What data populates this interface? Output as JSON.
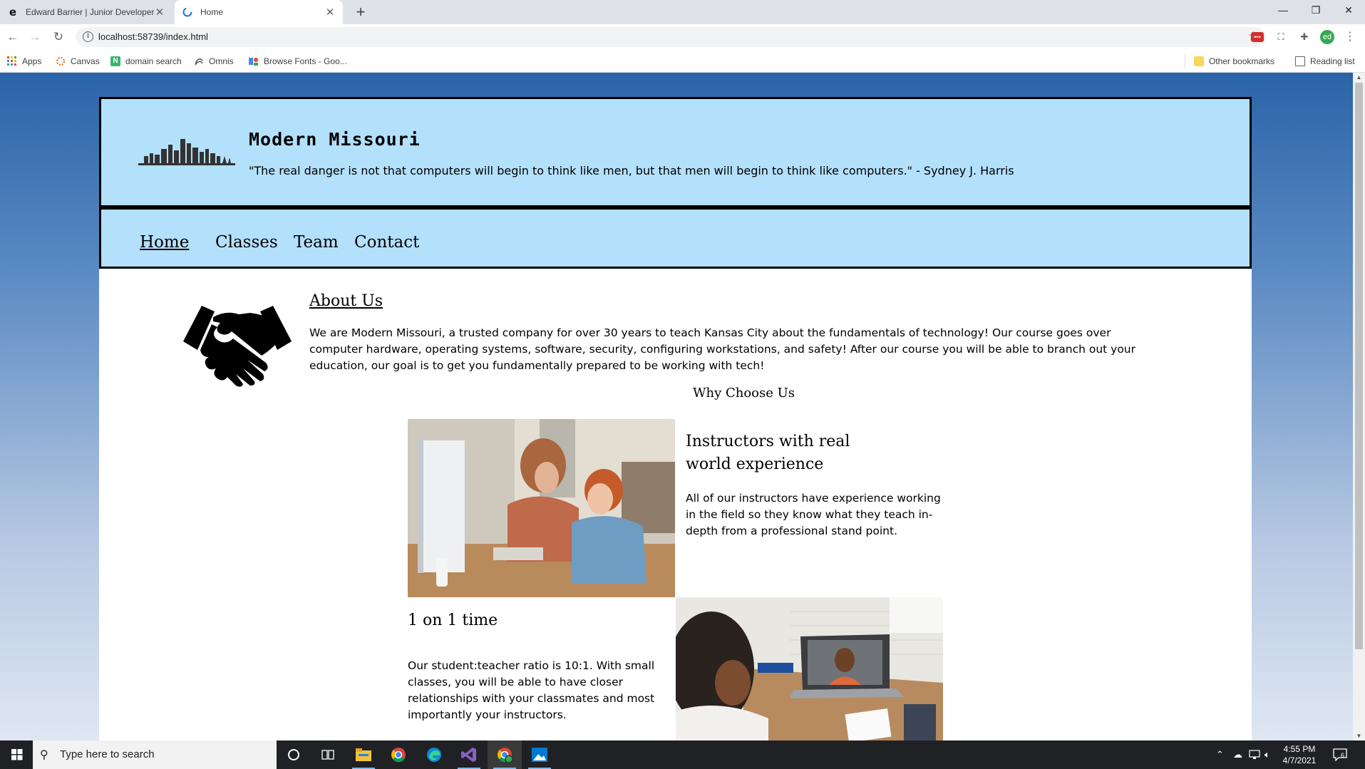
{
  "browser": {
    "tabs": [
      {
        "title": "Edward Barrier | Junior Developer",
        "active": false
      },
      {
        "title": "Home",
        "active": true
      }
    ],
    "url": "localhost:58739/index.html",
    "profile_initials": "ed",
    "bookmarks": [
      {
        "label": "Apps",
        "icon": "apps-grid-icon"
      },
      {
        "label": "Canvas",
        "icon": "canvas-icon"
      },
      {
        "label": "domain search",
        "icon": "n-icon"
      },
      {
        "label": "Omnis",
        "icon": "omnis-icon"
      },
      {
        "label": "Browse Fonts - Goo...",
        "icon": "google-fonts-icon"
      }
    ],
    "other_bookmarks": "Other bookmarks",
    "reading_list": "Reading list"
  },
  "site": {
    "title": "Modern Missouri",
    "quote": "\"The real danger is not that computers will begin to think like men, but that men will begin to think like computers.\" - Sydney J. Harris",
    "nav": [
      "Home",
      "Classes",
      "Team",
      "Contact"
    ],
    "current_nav": "Home",
    "about": {
      "heading": "About Us",
      "text": "We are Modern Missouri, a trusted company for over 30 years to teach Kansas City about the fundamentals of technology! Our course goes over computer hardware, operating systems, software, security, configuring workstations, and safety! After our course you will be able to branch out your education, our goal is to get you fundamentally prepared to be working with tech!"
    },
    "why_heading": "Why Choose Us",
    "features": [
      {
        "title": "Instructors with real world experience",
        "text": "All of our instructors have experience working in the field so they know what they teach in-depth from a professional stand point."
      },
      {
        "title": "1 on 1 time",
        "text": "Our student:teacher ratio is 10:1. With small classes, you will be able to have closer relationships with your classmates and most importantly your instructors."
      }
    ]
  },
  "taskbar": {
    "search_placeholder": "Type here to search",
    "time": "4:55 PM",
    "date": "4/7/2021",
    "notification_count": "6"
  },
  "colors": {
    "banner": "#b3e0fb",
    "page_gradient_top": "#2a64a8",
    "page_gradient_bottom": "#dfe7f3",
    "taskbar": "#202124"
  }
}
